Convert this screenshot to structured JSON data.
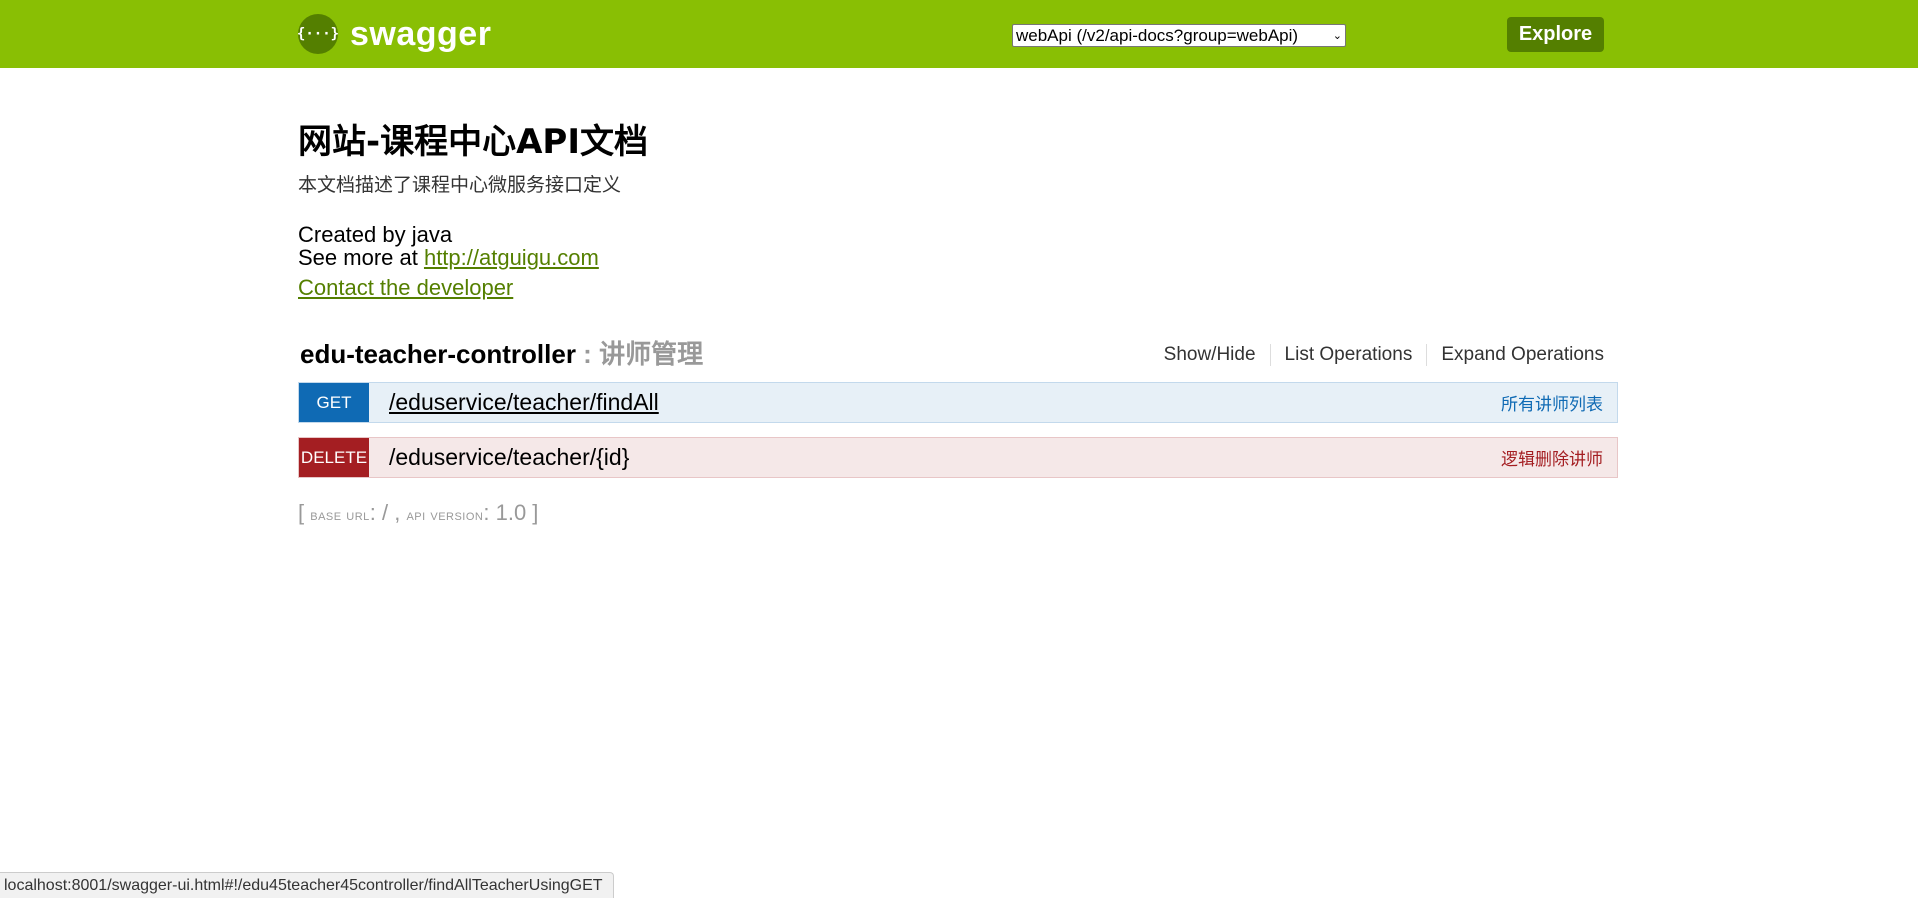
{
  "header": {
    "logo_icon_text": "{···}",
    "logo_text": "swagger",
    "api_select_value": "webApi (/v2/api-docs?group=webApi)",
    "explore_label": "Explore",
    "brand_color": "#89bf04"
  },
  "info": {
    "title": "网站-课程中心API文档",
    "description": "本文档描述了课程中心微服务接口定义",
    "created_by": "Created by java",
    "see_more_prefix": "See more at ",
    "see_more_link": "http://atguigu.com",
    "contact_link": "Contact the developer"
  },
  "resource": {
    "name": "edu-teacher-controller",
    "separator": " : ",
    "description": "讲师管理",
    "links": [
      "Show/Hide",
      "List Operations",
      "Expand Operations"
    ],
    "operations": [
      {
        "method": "GET",
        "path": "/eduservice/teacher/findAll",
        "summary": "所有讲师列表",
        "color": "#0f6ab4"
      },
      {
        "method": "DELETE",
        "path": "/eduservice/teacher/{id}",
        "summary": "逻辑删除讲师",
        "color": "#a41e22"
      }
    ]
  },
  "footer": {
    "open_bracket": "[ ",
    "base_url_label": "base url",
    "base_url_value": ": / , ",
    "api_version_label": "api version",
    "api_version_value": ": 1.0 ]"
  },
  "status_bar": {
    "url": "localhost:8001/swagger-ui.html#!/edu45teacher45controller/findAllTeacherUsingGET"
  }
}
